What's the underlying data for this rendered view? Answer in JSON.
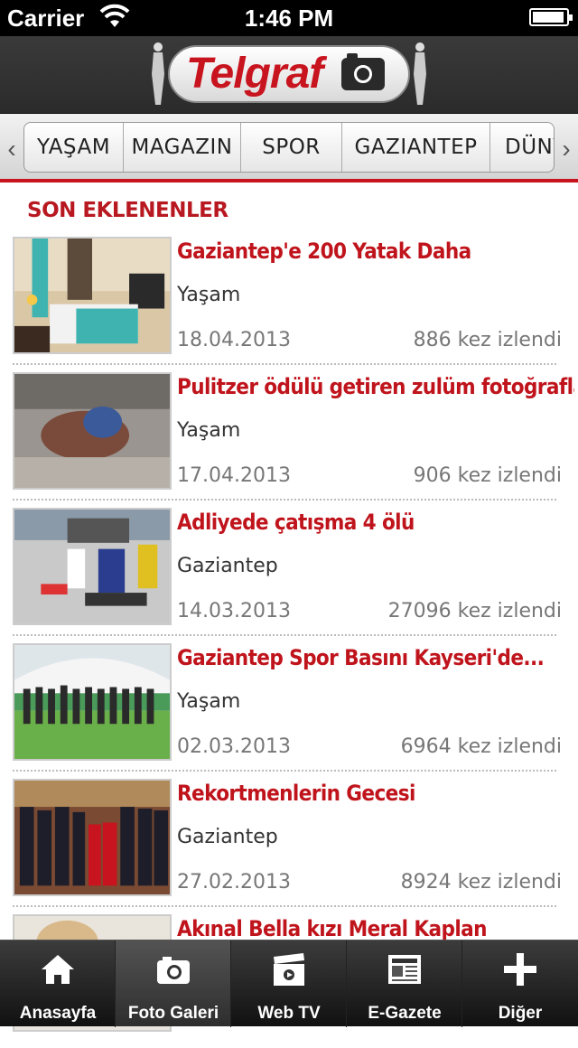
{
  "status": {
    "carrier": "Carrier",
    "time": "1:46 PM"
  },
  "header": {
    "logo_text": "Telgraf"
  },
  "categories": [
    "YAŞAM",
    "MAGAZIN",
    "SPOR",
    "GAZIANTEP",
    "DÜNYA"
  ],
  "section_title": "SON EKLENENLER",
  "items": [
    {
      "title": "Gaziantep'e 200 Yatak Daha",
      "category": "Yaşam",
      "date": "18.04.2013",
      "views": "886 kez izlendi"
    },
    {
      "title": "Pulitzer ödülü getiren zulüm fotoğrafları",
      "category": "Yaşam",
      "date": "17.04.2013",
      "views": "906 kez izlendi"
    },
    {
      "title": "Adliyede çatışma 4 ölü",
      "category": "Gaziantep",
      "date": "14.03.2013",
      "views": "27096 kez izlendi"
    },
    {
      "title": "Gaziantep Spor Basını Kayseri'de...",
      "category": "Yaşam",
      "date": "02.03.2013",
      "views": "6964 kez izlendi"
    },
    {
      "title": "Rekortmenlerin Gecesi",
      "category": "Gaziantep",
      "date": "27.02.2013",
      "views": "8924 kez izlendi"
    },
    {
      "title": "Akınal Bella kızı Meral Kaplan",
      "category": "",
      "date": "",
      "views": ""
    }
  ],
  "tabs": [
    {
      "label": "Anasayfa",
      "icon": "home-icon"
    },
    {
      "label": "Foto Galeri",
      "icon": "camera-icon"
    },
    {
      "label": "Web TV",
      "icon": "clapperboard-icon"
    },
    {
      "label": "E-Gazete",
      "icon": "newspaper-icon"
    },
    {
      "label": "Diğer",
      "icon": "plus-icon"
    }
  ],
  "colors": {
    "brand_red": "#c0141c",
    "tabbar_bg": "#1a1a1a"
  }
}
